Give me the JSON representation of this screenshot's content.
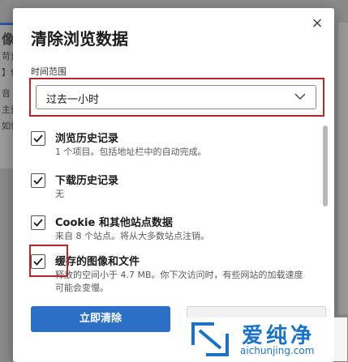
{
  "background": {
    "lines": [
      "像",
      "苛)",
      "】你",
      "音",
      "主预",
      "如你"
    ]
  },
  "dialog": {
    "title": "清除浏览数据",
    "close_glyph": "×",
    "time_range": {
      "label": "时间范围",
      "selected": "过去一小时"
    },
    "items": [
      {
        "label": "浏览历史记录",
        "desc": "1 个项目。包括地址栏中的自动完成。",
        "checked": true
      },
      {
        "label": "下载历史记录",
        "desc": "无",
        "checked": true
      },
      {
        "label": "Cookie 和其他站点数据",
        "desc": "来自 8 个站点。将从大多数站点注销。",
        "checked": true
      },
      {
        "label": "缓存的图像和文件",
        "desc": "释放的空间小于 4.7 MB。你下次访问时，有些网站的加载速度可能会变慢。",
        "checked": true
      }
    ],
    "clear_button": "立即清除"
  },
  "watermark": {
    "brand": "爱纯净",
    "url": "aichunjing.com"
  },
  "colors": {
    "accent": "#2b6fc7",
    "highlight_red": "#b5262c",
    "watermark_blue": "#1a73c8"
  }
}
